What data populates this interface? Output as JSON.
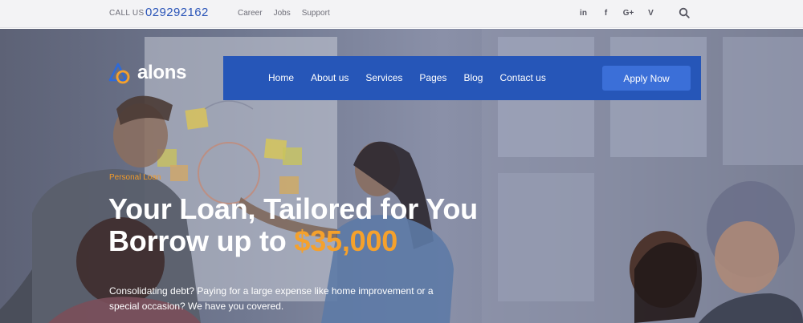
{
  "topbar": {
    "call_label": "CALL US",
    "phone": "029292162",
    "links": [
      "Career",
      "Jobs",
      "Support"
    ],
    "social_icons": [
      "linkedin-icon",
      "facebook-icon",
      "google-plus-icon",
      "vine-icon"
    ],
    "search_icon": "search-icon"
  },
  "brand": {
    "name": "alons",
    "accent_color": "#f5a12c",
    "primary_color": "#2656b8"
  },
  "nav": {
    "items": [
      "Home",
      "About us",
      "Services",
      "Pages",
      "Blog",
      "Contact us"
    ],
    "cta": "Apply Now"
  },
  "hero": {
    "eyebrow": "Personal Loan",
    "headline_line1": "Your Loan, Tailored for You",
    "headline_line2_prefix": "Borrow up to ",
    "headline_amount": "$35,000",
    "description": "Consolidating debt? Paying for a large expense like home improvement or a special occasion? We have you covered."
  }
}
